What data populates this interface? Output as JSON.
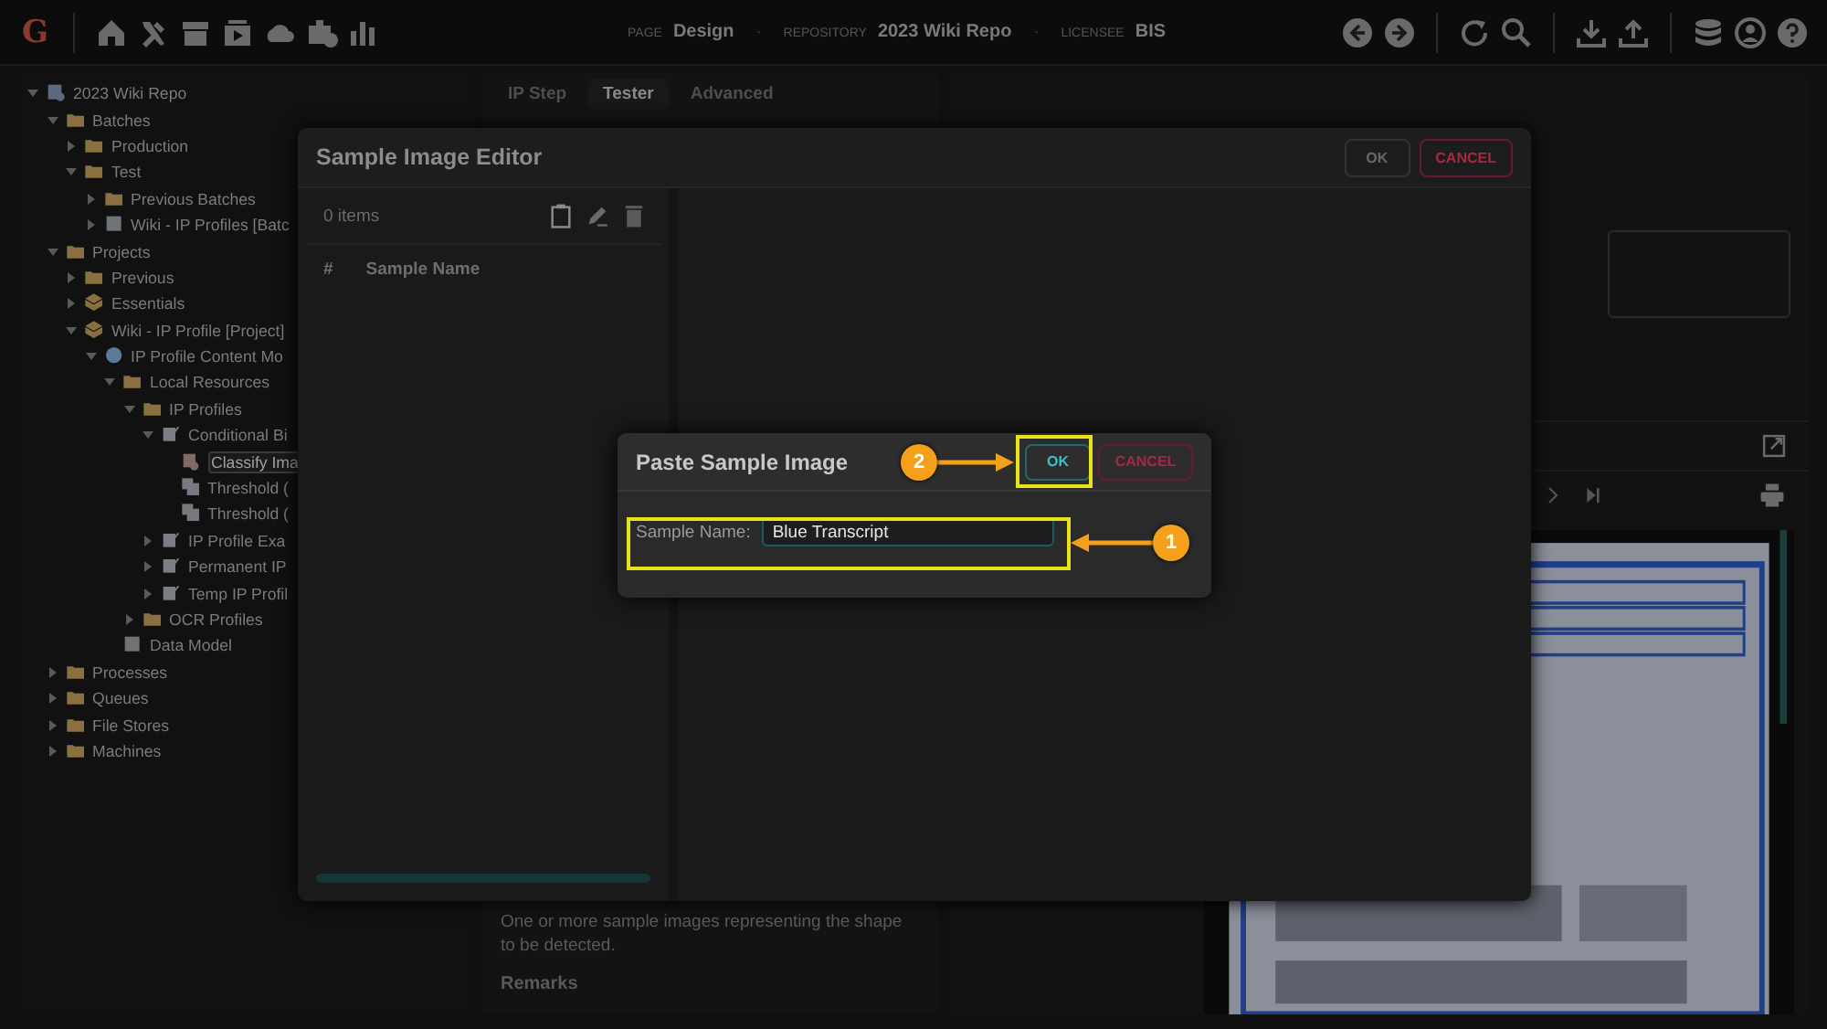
{
  "topbar": {
    "logo": "G",
    "breadcrumbs": [
      {
        "label": "PAGE",
        "value": "Design"
      },
      {
        "label": "REPOSITORY",
        "value": "2023 Wiki Repo"
      },
      {
        "label": "LICENSEE",
        "value": "BIS"
      }
    ],
    "separator": "·"
  },
  "tree": [
    {
      "label": "2023 Wiki Repo",
      "kind": "repo",
      "expandable": true,
      "expanded": true,
      "selected": false,
      "children": [
        {
          "label": "Batches",
          "kind": "folder",
          "expandable": true,
          "expanded": true,
          "selected": false,
          "children": [
            {
              "label": "Production",
              "kind": "folder",
              "expandable": true,
              "expanded": false,
              "selected": false
            },
            {
              "label": "Test",
              "kind": "folder",
              "expandable": true,
              "expanded": true,
              "selected": false,
              "children": [
                {
                  "label": "Previous Batches",
                  "kind": "folder",
                  "expandable": true,
                  "expanded": false,
                  "selected": false
                },
                {
                  "label": "Wiki - IP Profiles [Batc",
                  "kind": "batch",
                  "expandable": true,
                  "expanded": false,
                  "selected": false
                }
              ]
            }
          ]
        },
        {
          "label": "Projects",
          "kind": "folder",
          "expandable": true,
          "expanded": true,
          "selected": false,
          "children": [
            {
              "label": "Previous",
              "kind": "folder",
              "expandable": true,
              "expanded": false,
              "selected": false
            },
            {
              "label": "Essentials",
              "kind": "project",
              "expandable": true,
              "expanded": false,
              "selected": false
            },
            {
              "label": "Wiki - IP Profile [Project]",
              "kind": "project",
              "expandable": true,
              "expanded": true,
              "selected": false,
              "children": [
                {
                  "label": "IP Profile Content Mo",
                  "kind": "model",
                  "expandable": true,
                  "expanded": true,
                  "selected": false,
                  "children": [
                    {
                      "label": "Local Resources",
                      "kind": "folder",
                      "expandable": true,
                      "expanded": true,
                      "selected": false,
                      "children": [
                        {
                          "label": "IP Profiles",
                          "kind": "folder",
                          "expandable": true,
                          "expanded": true,
                          "selected": false,
                          "children": [
                            {
                              "label": "Conditional Bi",
                              "kind": "profile",
                              "expandable": true,
                              "expanded": true,
                              "selected": false,
                              "children": [
                                {
                                  "label": "Classify Ima",
                                  "kind": "step",
                                  "expandable": false,
                                  "selected": true
                                },
                                {
                                  "label": "Threshold (",
                                  "kind": "threshold",
                                  "expandable": false,
                                  "selected": false
                                },
                                {
                                  "label": "Threshold (",
                                  "kind": "threshold",
                                  "expandable": false,
                                  "selected": false
                                }
                              ]
                            },
                            {
                              "label": "IP Profile Exa",
                              "kind": "profile",
                              "expandable": true,
                              "expanded": false,
                              "selected": false
                            },
                            {
                              "label": "Permanent IP",
                              "kind": "profile",
                              "expandable": true,
                              "expanded": false,
                              "selected": false
                            },
                            {
                              "label": "Temp IP Profil",
                              "kind": "profile",
                              "expandable": true,
                              "expanded": false,
                              "selected": false
                            }
                          ]
                        },
                        {
                          "label": "OCR Profiles",
                          "kind": "folder",
                          "expandable": true,
                          "expanded": false,
                          "selected": false
                        }
                      ]
                    },
                    {
                      "label": "Data Model",
                      "kind": "batch",
                      "expandable": false,
                      "selected": false
                    }
                  ]
                }
              ]
            }
          ]
        },
        {
          "label": "Processes",
          "kind": "folder",
          "expandable": true,
          "expanded": false,
          "selected": false
        },
        {
          "label": "Queues",
          "kind": "folder",
          "expandable": true,
          "expanded": false,
          "selected": false
        },
        {
          "label": "File Stores",
          "kind": "folder",
          "expandable": true,
          "expanded": false,
          "selected": false
        },
        {
          "label": "Machines",
          "kind": "folder",
          "expandable": true,
          "expanded": false,
          "selected": false
        }
      ]
    }
  ],
  "center": {
    "tabs": [
      {
        "label": "IP Step",
        "selected": false
      },
      {
        "label": "Tester",
        "selected": true
      },
      {
        "label": "Advanced",
        "selected": false
      }
    ],
    "description": "One or more sample images representing the shape to be detected.",
    "next_heading": "Remarks"
  },
  "editor": {
    "title": "Sample Image Editor",
    "ok": {
      "label": "OK",
      "disabled": true
    },
    "cancel": "CANCEL",
    "count": "0 items",
    "columns": [
      "#",
      "Sample Name"
    ]
  },
  "paste_dialog": {
    "title": "Paste Sample Image",
    "ok": {
      "label": "OK",
      "disabled": false
    },
    "cancel": "CANCEL",
    "field": {
      "label": "Sample Name:",
      "value": "Blue Transcript"
    }
  },
  "annotations": [
    {
      "number": "2"
    },
    {
      "number": "1"
    }
  ]
}
